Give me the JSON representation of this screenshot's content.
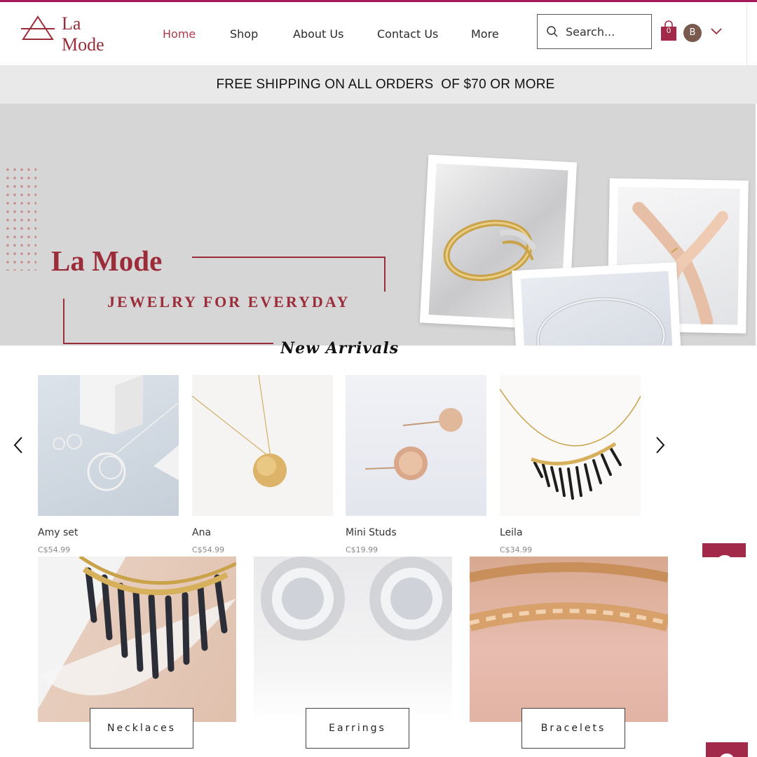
{
  "brand": {
    "name_line1": "La",
    "name_line2": "Mode",
    "color": "#9b2c3a"
  },
  "nav": {
    "items": [
      {
        "label": "Home",
        "active": true
      },
      {
        "label": "Shop"
      },
      {
        "label": "About Us"
      },
      {
        "label": "Contact Us"
      },
      {
        "label": "More"
      }
    ]
  },
  "search": {
    "placeholder": "Search...",
    "icon": "search-icon"
  },
  "cart": {
    "count": "0",
    "icon": "shopping-bag-icon",
    "color": "#a3294a"
  },
  "account": {
    "initial": "B",
    "icon": "chevron-down-icon"
  },
  "promo": {
    "text": "FREE SHIPPING ON ALL ORDERS  OF $70 OR MORE"
  },
  "hero": {
    "title": "La Mode",
    "subtitle": "JEWELRY FOR EVERYDAY"
  },
  "arrivals": {
    "title": "New Arrivals",
    "products": [
      {
        "name": "Amy set",
        "price": "C$54.99"
      },
      {
        "name": "Ana",
        "price": "C$54.99"
      },
      {
        "name": "Mini Studs",
        "price": "C$19.99"
      },
      {
        "name": "Leila",
        "price": "C$34.99"
      }
    ]
  },
  "categories": [
    {
      "label": "Necklaces"
    },
    {
      "label": "Earrings"
    },
    {
      "label": "Bracelets"
    }
  ],
  "colors": {
    "accent": "#a3195b",
    "banner_bg": "#e9e9e9",
    "hero_bg": "#d6d6d6"
  }
}
